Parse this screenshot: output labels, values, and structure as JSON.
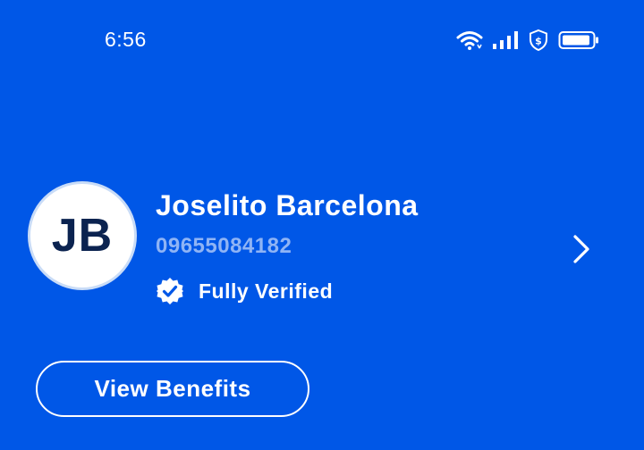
{
  "status_bar": {
    "time": "6:56",
    "icons": [
      "wifi-icon",
      "signal-icon",
      "shield-dollar-icon",
      "battery-icon"
    ]
  },
  "profile": {
    "initials": "JB",
    "name": "Joselito Barcelona",
    "phone": "09655084182",
    "verification_status": "Fully Verified"
  },
  "actions": {
    "view_benefits_label": "View Benefits"
  },
  "colors": {
    "background": "#0057e7",
    "phone_text": "#8fb4f5",
    "avatar_text": "#0b2350"
  }
}
